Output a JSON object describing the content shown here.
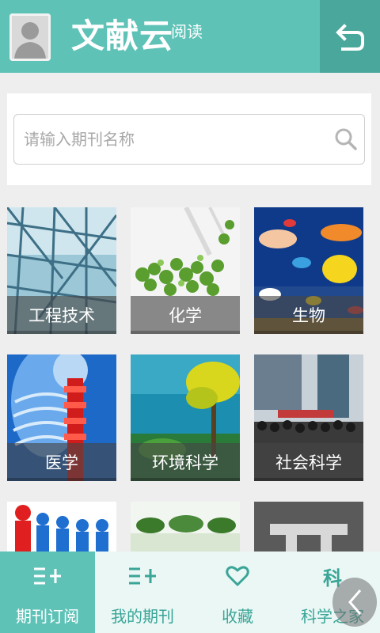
{
  "header": {
    "title": "文献云",
    "subtitle": "阅读",
    "avatar_icon": "user-avatar-icon",
    "back_icon": "back-arrow-icon",
    "bg_color": "#5ec2b7"
  },
  "search": {
    "placeholder": "请输入期刊名称",
    "value": "",
    "icon": "search-icon"
  },
  "categories": [
    {
      "label": "工程技术"
    },
    {
      "label": "化学"
    },
    {
      "label": "生物"
    },
    {
      "label": "医学"
    },
    {
      "label": "环境科学"
    },
    {
      "label": "社会科学"
    },
    {
      "label": ""
    },
    {
      "label": ""
    },
    {
      "label": ""
    }
  ],
  "bottom_nav": {
    "items": [
      {
        "label": "期刊订阅",
        "icon": "list-add-icon",
        "active": true
      },
      {
        "label": "我的期刊",
        "icon": "list-add-icon",
        "active": false
      },
      {
        "label": "收藏",
        "icon": "heart-icon",
        "active": false
      },
      {
        "label": "科学之家",
        "icon": "science-home-icon",
        "active": false
      }
    ],
    "nav_icon_text": "科"
  }
}
